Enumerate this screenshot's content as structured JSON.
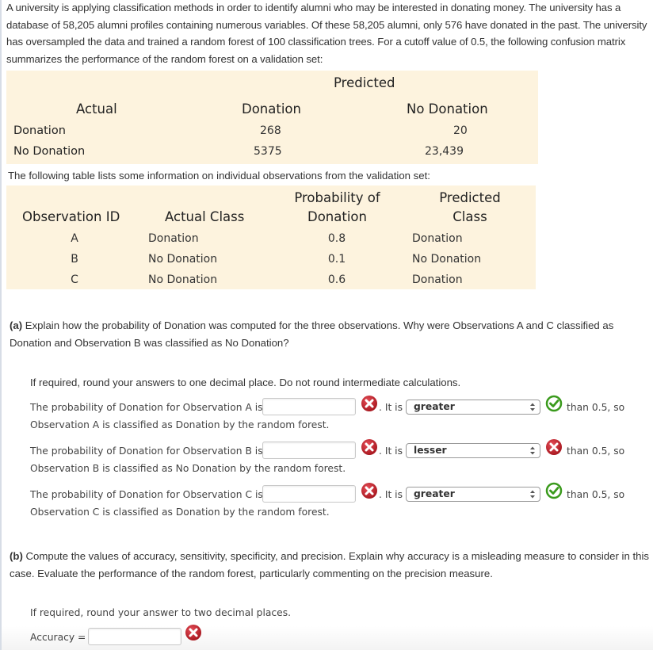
{
  "intro": {
    "text": "A university is applying classification methods in order to identify alumni who may be interested in donating money. The university has a database of 58,205 alumni profiles containing numerous variables. Of these 58,205 alumni, only 576 have donated in the past. The university has oversampled the data and trained a random forest of 100 classification trees. For a cutoff value of 0.5, the following confusion matrix summarizes the performance of the random forest on a validation set:"
  },
  "confusion_matrix": {
    "predicted_header": "Predicted",
    "actual_header": "Actual",
    "columns": [
      "Donation",
      "No Donation"
    ],
    "rows": [
      {
        "label": "Donation",
        "values": [
          "268",
          "20"
        ]
      },
      {
        "label": "No Donation",
        "values": [
          "5375",
          "23,439"
        ]
      }
    ]
  },
  "between_text": "The following table lists some information on individual observations from the validation set:",
  "observations": {
    "headers": {
      "id": "Observation ID",
      "actual": "Actual Class",
      "prob_line1": "Probability of",
      "prob_line2": "Donation",
      "pred_line1": "Predicted",
      "pred_line2": "Class"
    },
    "rows": [
      {
        "id": "A",
        "actual": "Donation",
        "prob": "0.8",
        "pred": "Donation"
      },
      {
        "id": "B",
        "actual": "No Donation",
        "prob": "0.1",
        "pred": "No Donation"
      },
      {
        "id": "C",
        "actual": "No Donation",
        "prob": "0.6",
        "pred": "Donation"
      }
    ]
  },
  "part_a": {
    "label": "(a)",
    "question": "Explain how the probability of Donation was computed for the three observations. Why were Observations A and C classified as Donation and Observation B was classified as No Donation?",
    "instruction": "If required, round your answers to one decimal place. Do not round intermediate calculations.",
    "items": [
      {
        "prefix": "The probability of Donation for Observation A is",
        "value": "",
        "value_status": "incorrect",
        "it_is": ". It is",
        "select_value": "greater",
        "select_status": "correct",
        "suffix": "than 0.5, so",
        "second_line": "Observation A is classified as Donation by the random forest."
      },
      {
        "prefix": "The probability of Donation for Observation B is",
        "value": "",
        "value_status": "incorrect",
        "it_is": ". It is",
        "select_value": "lesser",
        "select_status": "incorrect",
        "suffix": "than 0.5, so",
        "second_line": "Observation B is classified as No Donation by the random forest."
      },
      {
        "prefix": "The probability of Donation for Observation C is",
        "value": "",
        "value_status": "incorrect",
        "it_is": ". It is",
        "select_value": "greater",
        "select_status": "correct",
        "suffix": "than 0.5, so",
        "second_line": "Observation C is classified as Donation by the random forest."
      }
    ]
  },
  "part_b": {
    "label": "(b)",
    "question": "Compute the values of accuracy, sensitivity, specificity, and precision. Explain why accuracy is a misleading measure to consider in this case. Evaluate the performance of the random forest, particularly commenting on the precision measure.",
    "instruction": "If required, round your answer to two decimal places.",
    "accuracy_label": "Accuracy =",
    "accuracy_value": "",
    "accuracy_status": "incorrect"
  },
  "colors": {
    "table_bg": "#fdf3de",
    "incorrect": "#c4202a",
    "correct": "#3a9a1c"
  }
}
